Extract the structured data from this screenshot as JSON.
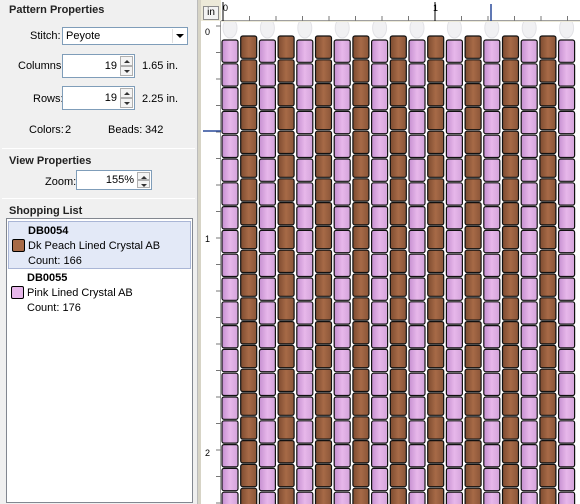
{
  "pattern_properties": {
    "heading": "Pattern Properties",
    "stitch_label": "Stitch:",
    "stitch_value": "Peyote",
    "columns_label": "Columns:",
    "columns_value": "19",
    "columns_in": "1.65 in.",
    "rows_label": "Rows:",
    "rows_value": "19",
    "rows_in": "2.25 in.",
    "colors_label": "Colors:",
    "colors_value": "2",
    "beads_label": "Beads:",
    "beads_value": "342"
  },
  "view_properties": {
    "heading": "View Properties",
    "zoom_label": "Zoom:",
    "zoom_value": "155%"
  },
  "shopping_list": {
    "heading": "Shopping List",
    "items": [
      {
        "code": "DB0054",
        "name": "Dk Peach Lined Crystal AB",
        "count": "Count: 166",
        "color": "#a76a47",
        "selected": true
      },
      {
        "code": "DB0055",
        "name": "Pink Lined Crystal AB",
        "count": "Count: 176",
        "color": "#e7b7ea",
        "selected": false
      }
    ]
  },
  "ruler": {
    "unit_button": "in",
    "h_labels": [
      "0",
      "1"
    ],
    "v_labels": [
      "0",
      "1",
      "2"
    ]
  },
  "colors": {
    "bead_dark": "#a76a47",
    "bead_light": "#e7b7ea",
    "ghost": "#f1f1f3"
  },
  "pattern": {
    "columns": 19,
    "rows": 19,
    "light_columns": [
      0,
      2,
      4,
      6,
      8,
      10,
      12,
      14,
      16,
      18
    ],
    "dark_columns": [
      1,
      3,
      5,
      7,
      9,
      11,
      13,
      15,
      17
    ]
  }
}
